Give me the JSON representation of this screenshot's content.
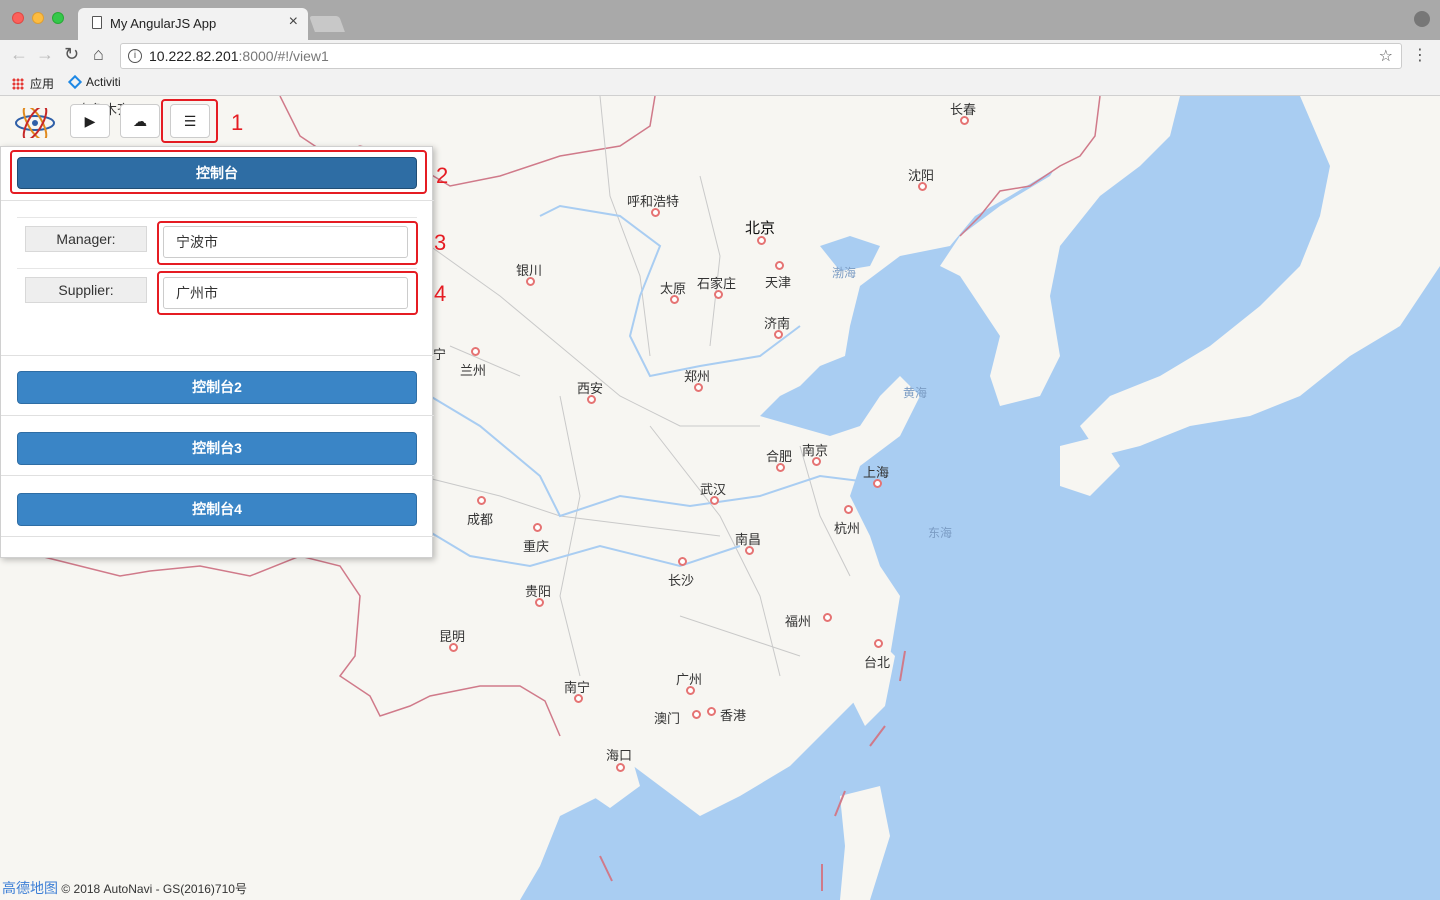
{
  "browser": {
    "tab_title": "My AngularJS App",
    "url_host": "10.222.82.201",
    "url_rest": ":8000/#!/view1",
    "bookmarks": [
      {
        "label": "应用"
      },
      {
        "label": "Activiti"
      }
    ]
  },
  "annotations": [
    "1",
    "2",
    "3",
    "4"
  ],
  "panel": {
    "header_button": "控制台",
    "fields": [
      {
        "label": "Manager:",
        "value": "宁波市"
      },
      {
        "label": "Supplier:",
        "value": "广州市"
      }
    ],
    "sections": [
      "控制台2",
      "控制台3",
      "控制台4"
    ]
  },
  "map": {
    "cities": [
      {
        "name": "长春"
      },
      {
        "name": "沈阳"
      },
      {
        "name": "呼和浩特"
      },
      {
        "name": "北京"
      },
      {
        "name": "天津"
      },
      {
        "name": "银川"
      },
      {
        "name": "太原"
      },
      {
        "name": "石家庄"
      },
      {
        "name": "济南"
      },
      {
        "name": "兰州"
      },
      {
        "name": "西安"
      },
      {
        "name": "郑州"
      },
      {
        "name": "合肥"
      },
      {
        "name": "南京"
      },
      {
        "name": "上海"
      },
      {
        "name": "武汉"
      },
      {
        "name": "成都"
      },
      {
        "name": "重庆"
      },
      {
        "name": "杭州"
      },
      {
        "name": "南昌"
      },
      {
        "name": "长沙"
      },
      {
        "name": "贵阳"
      },
      {
        "name": "福州"
      },
      {
        "name": "昆明"
      },
      {
        "name": "台北"
      },
      {
        "name": "南宁"
      },
      {
        "name": "广州"
      },
      {
        "name": "澳门"
      },
      {
        "name": "香港"
      },
      {
        "name": "海口"
      },
      {
        "name": "乌鲁木齐"
      },
      {
        "name": "西宁"
      }
    ],
    "seas": [
      "渤海",
      "黄海",
      "东海"
    ],
    "attribution_logo": "高德地图",
    "attribution_text": "© 2018 AutoNavi - GS(2016)710号"
  }
}
